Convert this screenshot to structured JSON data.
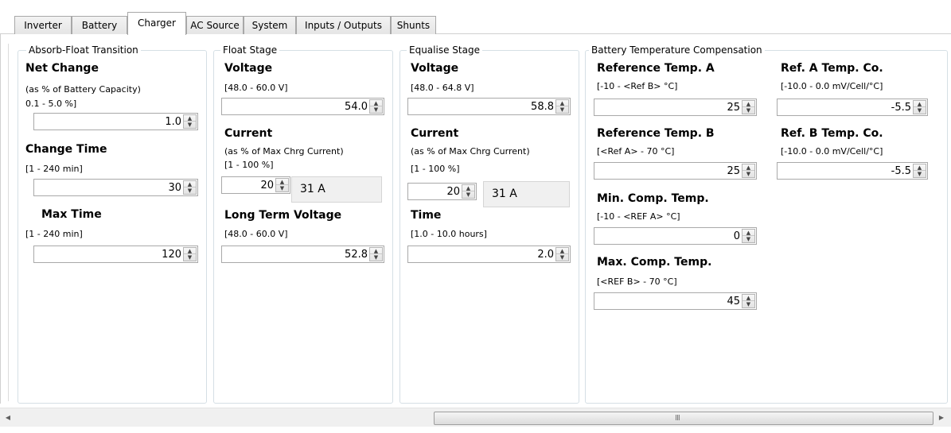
{
  "tabs": [
    "Inverter",
    "Battery",
    "Charger",
    "AC Source",
    "System",
    "Inputs / Outputs",
    "Shunts"
  ],
  "absorb": {
    "legend": "Absorb-Float Transition",
    "net_change": {
      "title": "Net Change",
      "sub1": "(as % of Battery Capacity)",
      "sub2": "0.1 - 5.0 %]",
      "value": "1.0"
    },
    "change_time": {
      "title": "Change Time",
      "range": "[1 - 240 min]",
      "value": "30"
    },
    "max_time": {
      "title": "Max Time",
      "range": "[1 - 240 min]",
      "value": "120"
    }
  },
  "float": {
    "legend": "Float Stage",
    "voltage": {
      "title": "Voltage",
      "range": "[48.0 - 60.0 V]",
      "value": "54.0"
    },
    "current": {
      "title": "Current",
      "sub1": "(as % of Max Chrg Current)",
      "range": "[1 - 100 %]",
      "value": "20",
      "amps": "31 A"
    },
    "long_term": {
      "title": "Long Term Voltage",
      "range": "[48.0 - 60.0 V]",
      "value": "52.8"
    }
  },
  "equalise": {
    "legend": "Equalise Stage",
    "voltage": {
      "title": "Voltage",
      "range": "[48.0 - 64.8 V]",
      "value": "58.8"
    },
    "current": {
      "title": "Current",
      "sub1": "(as % of Max Chrg Current)",
      "range": "[1 - 100 %]",
      "value": "20",
      "amps": "31 A"
    },
    "time": {
      "title": "Time",
      "range": "[1.0 - 10.0 hours]",
      "value": "2.0"
    }
  },
  "temp": {
    "legend": "Battery Temperature Compensation",
    "ref_a": {
      "title": "Reference Temp. A",
      "range": "[-10 - <Ref B> °C]",
      "value": "25"
    },
    "ref_b": {
      "title": "Reference Temp. B",
      "range": "[<Ref A> - 70 °C]",
      "value": "25"
    },
    "min_comp": {
      "title": "Min. Comp. Temp.",
      "range": "[-10 - <REF A> °C]",
      "value": "0"
    },
    "max_comp": {
      "title": "Max. Comp. Temp.",
      "range": "[<REF B> - 70 °C]",
      "value": "45"
    },
    "ref_a_co": {
      "title": "Ref. A Temp. Co.",
      "range": "[-10.0 - 0.0 mV/Cell/°C]",
      "value": "-5.5"
    },
    "ref_b_co": {
      "title": "Ref. B Temp. Co.",
      "range": "[-10.0 - 0.0 mV/Cell/°C]",
      "value": "-5.5"
    }
  },
  "scrollbar": {
    "grip": "III"
  },
  "icons": {
    "spin_up": "up-arrow-icon",
    "spin_down": "down-arrow-icon",
    "scroll_left": "scroll-left-icon",
    "scroll_right": "scroll-right-icon"
  }
}
